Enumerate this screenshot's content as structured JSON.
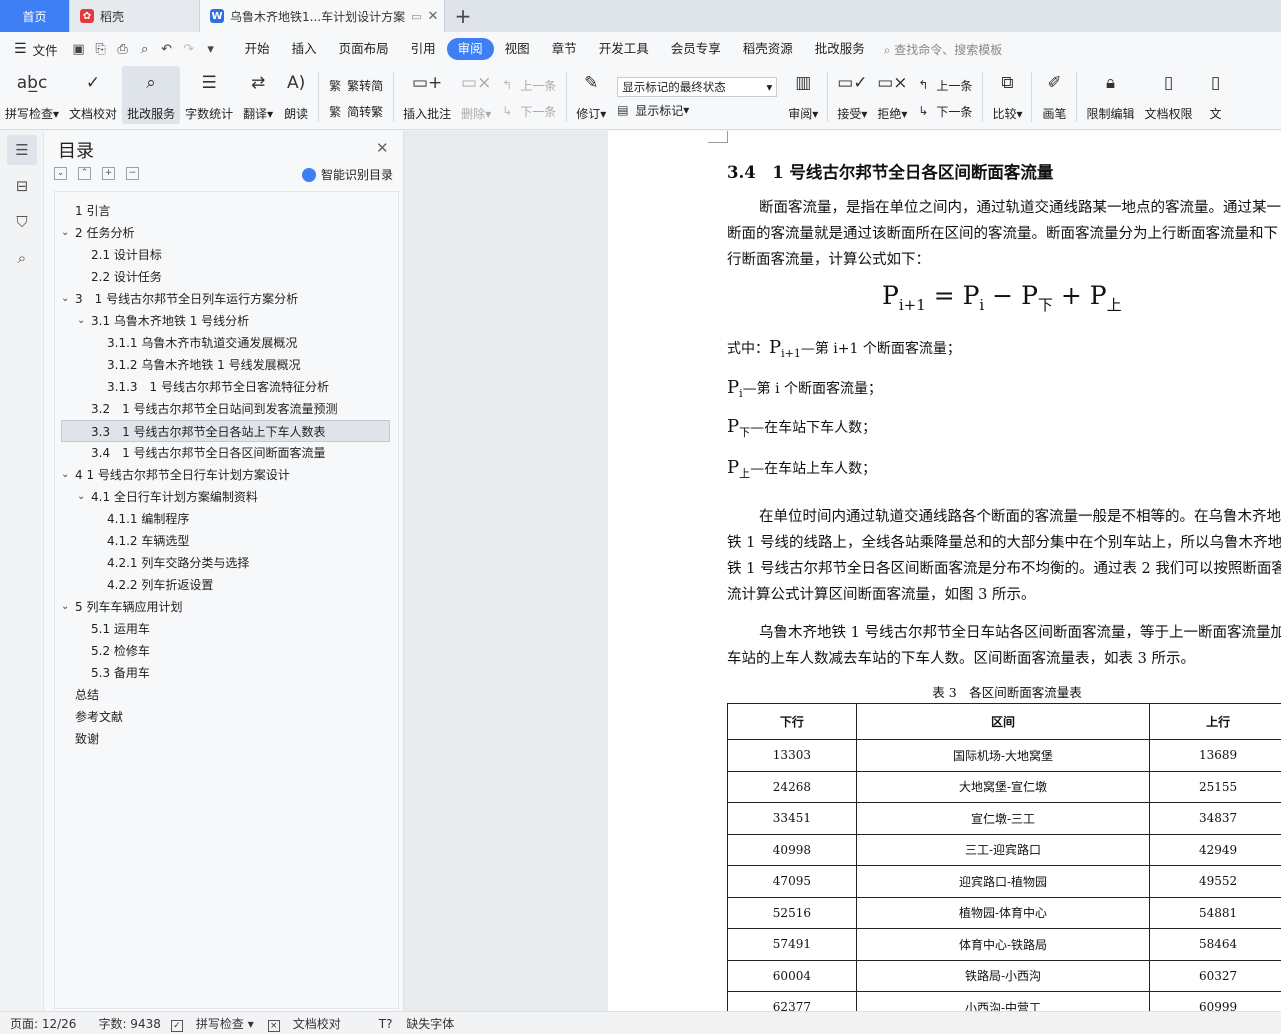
{
  "tabs": {
    "home": "首页",
    "shell": "稻壳",
    "doc": "乌鲁木齐地铁1...车计划设计方案"
  },
  "menu": {
    "file": "文件",
    "items": [
      "开始",
      "插入",
      "页面布局",
      "引用",
      "审阅",
      "视图",
      "章节",
      "开发工具",
      "会员专享",
      "稻壳资源",
      "批改服务"
    ],
    "active_index": 4,
    "search": "查找命令、搜索模板"
  },
  "ribbon": {
    "spellcheck": "拼写检查",
    "doccheck": "文档校对",
    "review_service": "批改服务",
    "wordcount": "字数统计",
    "translate": "翻译",
    "read": "朗读",
    "trad": "繁转简",
    "simp": "简转繁",
    "insert_comment": "插入批注",
    "delete": "删除",
    "prev": "上一条",
    "next": "下一条",
    "revise": "修订",
    "markup_state": "显示标记的最终状态",
    "show_markup": "显示标记",
    "review": "审阅",
    "accept": "接受",
    "reject": "拒绝",
    "prev2": "上一条",
    "next2": "下一条",
    "compare": "比较",
    "pen": "画笔",
    "restrict": "限制编辑",
    "perm": "文档权限",
    "more": "文"
  },
  "toc": {
    "title": "目录",
    "smart": "智能识别目录",
    "items": [
      {
        "label": "1 引言",
        "level": 1,
        "arrow": ""
      },
      {
        "label": "2 任务分析",
        "level": 1,
        "arrow": "v"
      },
      {
        "label": "2.1 设计目标",
        "level": 2,
        "arrow": ""
      },
      {
        "label": "2.2 设计任务",
        "level": 2,
        "arrow": ""
      },
      {
        "label": "3　1 号线古尔邦节全日列车运行方案分析",
        "level": 1,
        "arrow": "v"
      },
      {
        "label": "3.1 乌鲁木齐地铁 1 号线分析",
        "level": 2,
        "arrow": "v"
      },
      {
        "label": "3.1.1 乌鲁木齐市轨道交通发展概况",
        "level": 3,
        "arrow": ""
      },
      {
        "label": "3.1.2 乌鲁木齐地铁 1 号线发展概况",
        "level": 3,
        "arrow": ""
      },
      {
        "label": "3.1.3　1 号线古尔邦节全日客流特征分析",
        "level": 3,
        "arrow": ""
      },
      {
        "label": "3.2　1 号线古尔邦节全日站间到发客流量预测",
        "level": 2,
        "arrow": ""
      },
      {
        "label": "3.3　1 号线古尔邦节全日各站上下车人数表",
        "level": 2,
        "arrow": "",
        "selected": true
      },
      {
        "label": "3.4　1 号线古尔邦节全日各区间断面客流量",
        "level": 2,
        "arrow": ""
      },
      {
        "label": "4 1 号线古尔邦节全日行车计划方案设计",
        "level": 1,
        "arrow": "v"
      },
      {
        "label": "4.1 全日行车计划方案编制资料",
        "level": 2,
        "arrow": "v"
      },
      {
        "label": "4.1.1 编制程序",
        "level": 3,
        "arrow": ""
      },
      {
        "label": "4.1.2 车辆选型",
        "level": 3,
        "arrow": ""
      },
      {
        "label": "4.2.1 列车交路分类与选择",
        "level": 3,
        "arrow": ""
      },
      {
        "label": "4.2.2 列车折返设置",
        "level": 3,
        "arrow": ""
      },
      {
        "label": "5 列车车辆应用计划",
        "level": 1,
        "arrow": "v"
      },
      {
        "label": "5.1 运用车",
        "level": 2,
        "arrow": ""
      },
      {
        "label": "5.2 检修车",
        "level": 2,
        "arrow": ""
      },
      {
        "label": "5.3 备用车",
        "level": 2,
        "arrow": ""
      },
      {
        "label": "总结",
        "level": 1,
        "arrow": ""
      },
      {
        "label": "参考文献",
        "level": 1,
        "arrow": ""
      },
      {
        "label": "致谢",
        "level": 1,
        "arrow": ""
      }
    ]
  },
  "doc": {
    "heading": "3.4　1 号线古尔邦节全日各区间断面客流量",
    "p1": "断面客流量，是指在单位之间内，通过轨道交通线路某一地点的客流量。通过某一断面的客流量就是通过该断面所在区间的客流量。断面客流量分为上行断面客流量和下行断面客流量，计算公式如下：",
    "formula": {
      "p": "P",
      "i1": "i+1",
      "i": "i",
      "eq": " = ",
      "minus": " − ",
      "plus": " + ",
      "down": "下",
      "up": "上"
    },
    "where1_pre": "式中：",
    "where1_post": "—第 i+1 个断面客流量；",
    "where2_post": "—第 i 个断面客流量；",
    "where3_post": "—在车站下车人数；",
    "where4_post": "—在车站上车人数；",
    "p2": "在单位时间内通过轨道交通线路各个断面的客流量一般是不相等的。在乌鲁木齐地铁 1 号线的线路上，全线各站乘降量总和的大部分集中在个别车站上，所以乌鲁木齐地铁 1 号线古尔邦节全日各区间断面客流是分布不均衡的。通过表 2 我们可以按照断面客流计算公式计算区间断面客流量，如图 3 所示。",
    "p3": "乌鲁木齐地铁 1 号线古尔邦节全日车站各区间断面客流量，等于上一断面客流量加车站的上车人数减去车站的下车人数。区间断面客流量表，如表 3 所示。",
    "table_caption": "表 3　各区间断面客流量表",
    "table_headers": [
      "下行",
      "区间",
      "上行"
    ],
    "table_rows": [
      [
        "13303",
        "国际机场-大地窝堡",
        "13689"
      ],
      [
        "24268",
        "大地窝堡-宣仁墩",
        "25155"
      ],
      [
        "33451",
        "宣仁墩-三工",
        "34837"
      ],
      [
        "40998",
        "三工-迎宾路口",
        "42949"
      ],
      [
        "47095",
        "迎宾路口-植物园",
        "49552"
      ],
      [
        "52516",
        "植物园-体育中心",
        "54881"
      ],
      [
        "57491",
        "体育中心-铁路局",
        "58464"
      ],
      [
        "60004",
        "铁路局-小西沟",
        "60327"
      ],
      [
        "62377",
        "小西沟-中营工",
        "60999"
      ]
    ]
  },
  "status": {
    "page": "页面: 12/26",
    "words": "字数: 9438",
    "spell": "拼写检查",
    "check": "文档校对",
    "font": "缺失字体"
  }
}
